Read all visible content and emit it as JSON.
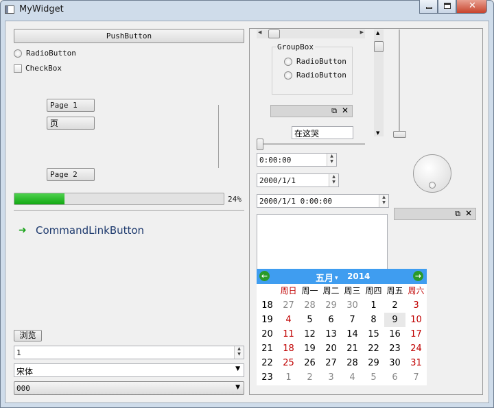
{
  "window": {
    "title": "MyWidget"
  },
  "left": {
    "push_button": "PushButton",
    "radio": "RadioButton",
    "checkbox": "CheckBox",
    "page1": "Page 1",
    "page_label": "页",
    "page2": "Page 2",
    "progress": {
      "value": 0.24,
      "label": "24%"
    },
    "command_link": "CommandLinkButton",
    "browse": "浏览",
    "spin_value": "1",
    "font_combo": "宋体",
    "combo": "000"
  },
  "right": {
    "groupbox_title": "GroupBox",
    "group_radio1": "RadioButton",
    "group_radio2": "RadioButton",
    "line_edit": "在这哭",
    "time_edit": "0:00:00",
    "date_edit": "2000/1/1",
    "datetime_edit": "2000/1/1 0:00:00",
    "calendar": {
      "month": "五月",
      "year": "2014",
      "headers": [
        "周日",
        "周一",
        "周二",
        "周三",
        "周四",
        "周五",
        "周六"
      ],
      "weeks": [
        "18",
        "19",
        "20",
        "21",
        "22",
        "23"
      ],
      "days": [
        [
          "27",
          "28",
          "29",
          "30",
          "1",
          "2",
          "3"
        ],
        [
          "4",
          "5",
          "6",
          "7",
          "8",
          "9",
          "10"
        ],
        [
          "11",
          "12",
          "13",
          "14",
          "15",
          "16",
          "17"
        ],
        [
          "18",
          "19",
          "20",
          "21",
          "22",
          "23",
          "24"
        ],
        [
          "25",
          "26",
          "27",
          "28",
          "29",
          "30",
          "31"
        ],
        [
          "1",
          "2",
          "3",
          "4",
          "5",
          "6",
          "7"
        ]
      ],
      "accent": "#3f9df0"
    }
  }
}
